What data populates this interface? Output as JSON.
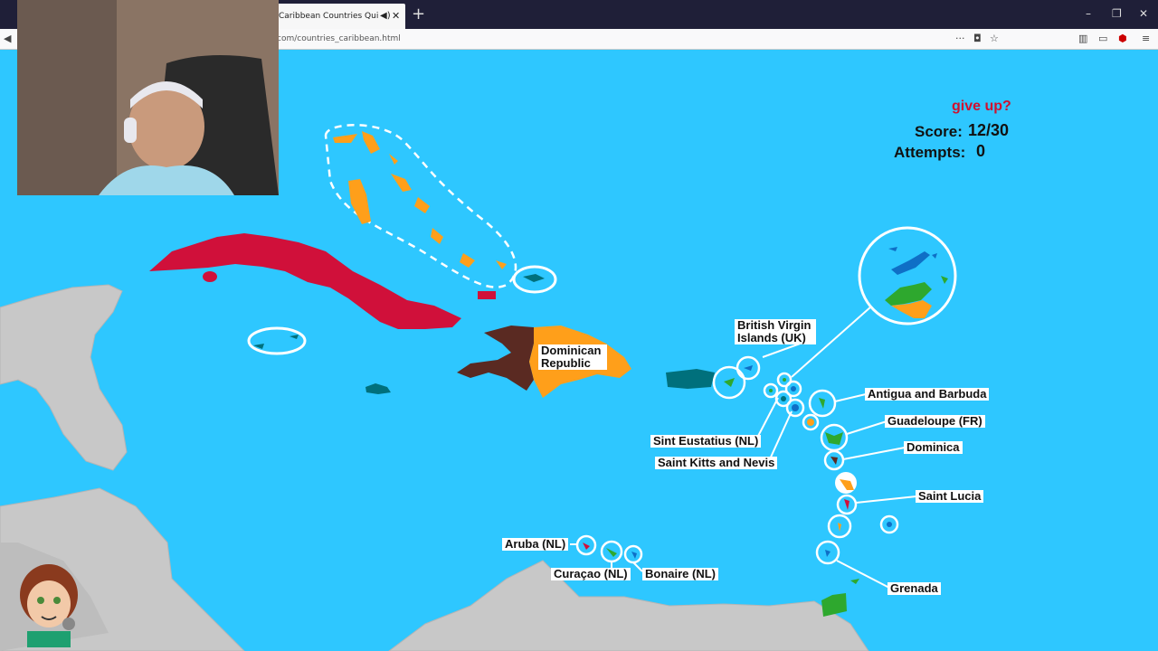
{
  "browser": {
    "tab_title": "Caribbean Countries Quiz - Wo",
    "url": "com/countries_caribbean.html",
    "new_tab": "+",
    "tab_close": "✕",
    "minimize": "–",
    "restore": "❐",
    "close": "✕",
    "menu": "≡",
    "dots": "···"
  },
  "quiz": {
    "give_up": "give up?",
    "score_label": "Score:",
    "score_value": "12/30",
    "attempts_label": "Attempts:",
    "attempts_value": "0"
  },
  "labels": {
    "dominican_republic": "Dominican Republic",
    "british_virgin_islands": "British Virgin Islands (UK)",
    "antigua_and_barbuda": "Antigua and Barbuda",
    "guadeloupe": "Guadeloupe (FR)",
    "dominica": "Dominica",
    "saint_lucia": "Saint Lucia",
    "sint_eustatius": "Sint Eustatius (NL)",
    "saint_kitts_and_nevis": "Saint Kitts and Nevis",
    "aruba": "Aruba (NL)",
    "curacao": "Curaçao (NL)",
    "bonaire": "Bonaire (NL)",
    "grenada": "Grenada"
  },
  "colors": {
    "ocean": "#2ec7ff",
    "land": "#c8c8c8",
    "cuba": "#d0103a",
    "haiti": "#5a2a22",
    "dominican_republic": "#ff9f1a",
    "bahamas": "#ff9f1a",
    "teal": "#00707c",
    "green": "#2ea82e",
    "blue": "#0f6fc6",
    "give_up": "#d0102f"
  }
}
